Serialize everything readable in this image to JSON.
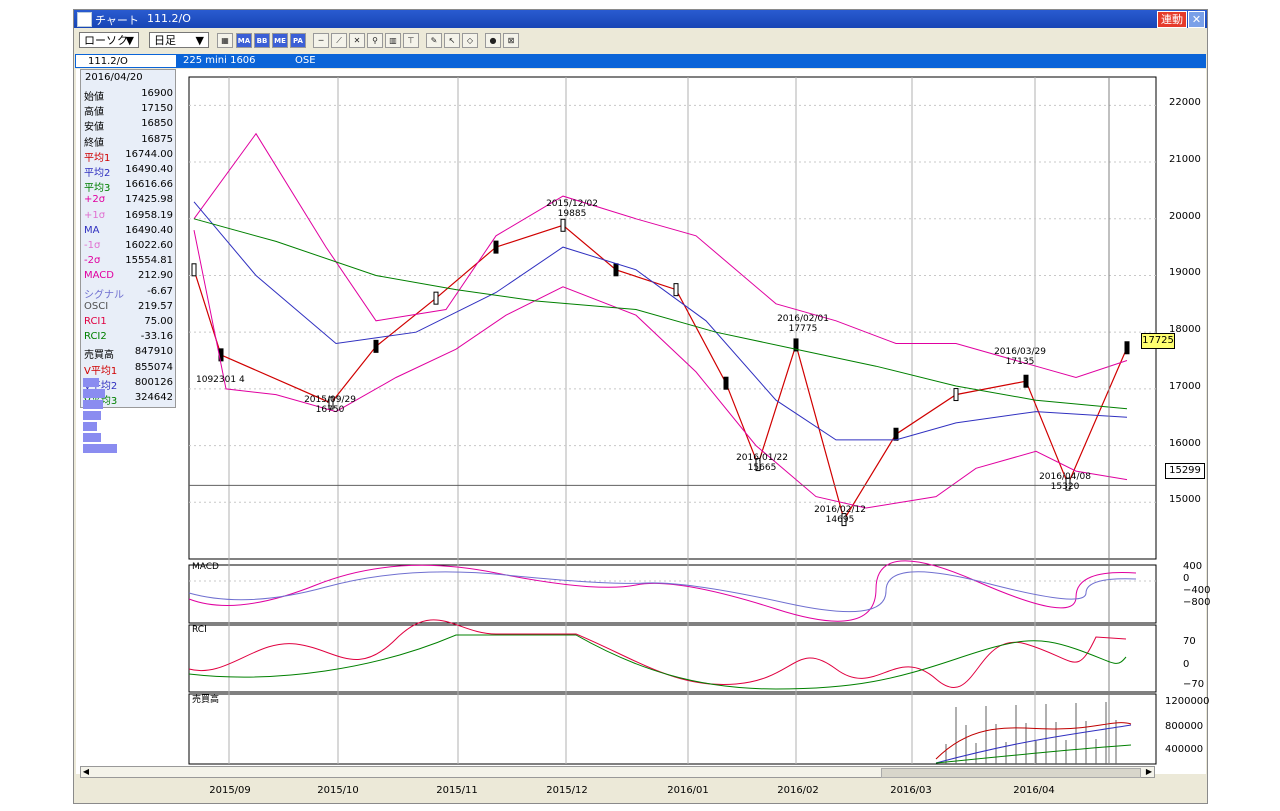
{
  "window": {
    "title": "チャート",
    "code_title": "111.2/O",
    "renDo_label": "連動",
    "close_glyph": "✕"
  },
  "toolbar": {
    "chart_type": "ローソク",
    "period": "日足",
    "dd_glyph": "▼",
    "indicator_buttons": [
      "MA",
      "BB",
      "ME",
      "PA"
    ]
  },
  "infobar": {
    "code": "111.2/O",
    "name": "225 mini 1606",
    "exchange": "OSE"
  },
  "infobox": {
    "date": "2016/04/20",
    "rows": [
      {
        "k": "始値",
        "v": "16900",
        "color": "#000000"
      },
      {
        "k": "高値",
        "v": "17150",
        "color": "#000000"
      },
      {
        "k": "安値",
        "v": "16850",
        "color": "#000000"
      },
      {
        "k": "終値",
        "v": "16875",
        "color": "#000000"
      },
      {
        "k": "平均1",
        "v": "16744.00",
        "color": "#d00000"
      },
      {
        "k": "平均2",
        "v": "16490.40",
        "color": "#3030c0"
      },
      {
        "k": "平均3",
        "v": "16616.66",
        "color": "#008000"
      },
      {
        "k": "+2σ",
        "v": "17425.98",
        "color": "#e000a0"
      },
      {
        "k": "+1σ",
        "v": "16958.19",
        "color": "#e070d0"
      },
      {
        "k": "MA",
        "v": "16490.40",
        "color": "#3030c0"
      },
      {
        "k": "-1σ",
        "v": "16022.60",
        "color": "#e070d0"
      },
      {
        "k": "-2σ",
        "v": "15554.81",
        "color": "#e000a0"
      },
      {
        "k": "MACD",
        "v": "212.90",
        "color": "#e000a0"
      },
      {
        "k": "シグナル",
        "v": "-6.67",
        "color": "#7070d0"
      },
      {
        "k": "OSCI",
        "v": "219.57",
        "color": "#505050"
      },
      {
        "k": "RCI1",
        "v": "75.00",
        "color": "#e00040"
      },
      {
        "k": "RCI2",
        "v": "-33.16",
        "color": "#008000"
      },
      {
        "k": "売買高",
        "v": "847910",
        "color": "#000000"
      },
      {
        "k": "V平均1",
        "v": "855074",
        "color": "#d00000"
      },
      {
        "k": "V平均2",
        "v": "800126",
        "color": "#3030c0"
      },
      {
        "k": "V平均3",
        "v": "324642",
        "color": "#008000"
      }
    ]
  },
  "price_axis": [
    "22000",
    "21000",
    "20000",
    "19000",
    "18000",
    "17000",
    "16000",
    "15000"
  ],
  "macd_axis": [
    "400",
    "0",
    "−400",
    "−800"
  ],
  "rci_axis": [
    "70",
    "0",
    "−70"
  ],
  "vol_axis": [
    "1200000",
    "800000",
    "400000"
  ],
  "pane_labels": {
    "macd": "MACD",
    "rci": "RCI",
    "volume": "売買高"
  },
  "date_labels": [
    "2015/09",
    "2015/10",
    "2015/11",
    "2015/12",
    "2016/01",
    "2016/02",
    "2016/03",
    "2016/04"
  ],
  "current_price": "17725",
  "lower_line_value": "15299",
  "volume_profile_label": "1092301 4",
  "annotations": [
    {
      "date": "2015/09/29",
      "value": "16750"
    },
    {
      "date": "2015/12/02",
      "value": "19885"
    },
    {
      "date": "2016/01/22",
      "value": "15665"
    },
    {
      "date": "2016/02/01",
      "value": "17775"
    },
    {
      "date": "2016/02/12",
      "value": "14695"
    },
    {
      "date": "2016/03/29",
      "value": "17135"
    },
    {
      "date": "2016/04/08",
      "value": "15320"
    }
  ],
  "colors": {
    "title_bar": "#1845b5",
    "info_bar": "#0a64d8",
    "ma1": "#d00000",
    "ma2": "#3030c0",
    "ma3": "#008000",
    "bb2": "#e000a0",
    "bb1": "#f090e0",
    "macd": "#e000a0",
    "signal": "#7070d0"
  },
  "chart_data": {
    "type": "candlestick",
    "title": "111.2/O",
    "ylim": [
      14000,
      22500
    ],
    "x": [
      "2015/08/31",
      "2015/09/15",
      "2015/09/29",
      "2015/10/15",
      "2015/10/30",
      "2015/11/16",
      "2015/12/02",
      "2015/12/15",
      "2015/12/30",
      "2016/01/15",
      "2016/01/22",
      "2016/02/01",
      "2016/02/12",
      "2016/02/29",
      "2016/03/15",
      "2016/03/29",
      "2016/04/08",
      "2016/04/20"
    ],
    "close": [
      19100,
      17600,
      16750,
      17750,
      18600,
      19500,
      19885,
      19100,
      18750,
      17100,
      15665,
      17775,
      14695,
      16200,
      16900,
      17135,
      15320,
      17725
    ]
  }
}
